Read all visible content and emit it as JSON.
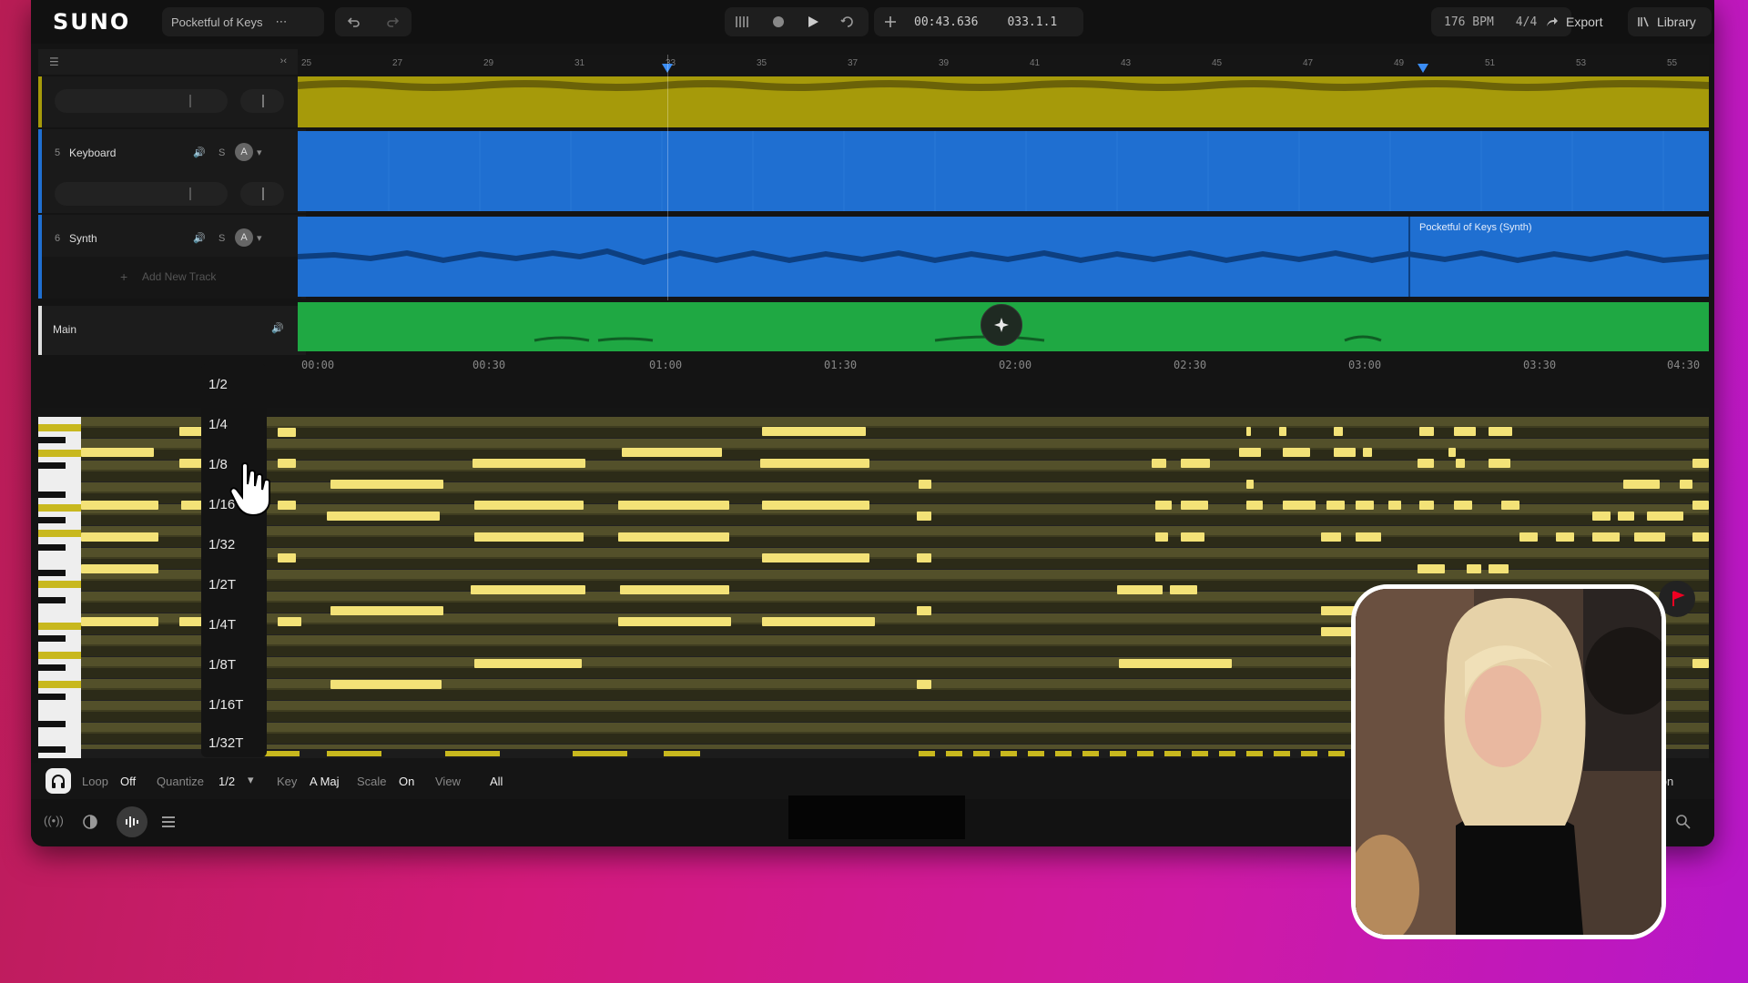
{
  "app": {
    "logo": "SUNO"
  },
  "header": {
    "project_title": "Pocketful of Keys",
    "more_label": "⋯",
    "time_display": "00:43.636",
    "bar_display": "033.1.1",
    "bpm": "176 BPM",
    "time_signature": "4/4",
    "export_label": "Export",
    "library_label": "Library"
  },
  "ruler_bars": [
    "25",
    "27",
    "29",
    "31",
    "33",
    "35",
    "37",
    "39",
    "41",
    "43",
    "45",
    "47",
    "49",
    "51",
    "53",
    "55"
  ],
  "tracks": [
    {
      "number": "",
      "name": "",
      "color": "#a69a0a"
    },
    {
      "number": "5",
      "name": "Keyboard",
      "color": "#1f6fd1",
      "solo": "S",
      "auto": "A"
    },
    {
      "number": "6",
      "name": "Synth",
      "color": "#1f6fd1",
      "solo": "S",
      "auto": "A",
      "clip_label": "Pocketful of Keys (Synth)"
    },
    {
      "name": "Main",
      "color": "#1fa843"
    }
  ],
  "add_track_label": "Add New Track",
  "time_ruler": [
    "00:00",
    "00:30",
    "01:00",
    "01:30",
    "02:00",
    "02:30",
    "03:00",
    "03:30",
    "04:30"
  ],
  "quantize_menu": [
    "1/2",
    "1/4",
    "1/8",
    "1/16",
    "1/32",
    "1/2T",
    "1/4T",
    "1/8T",
    "1/16T",
    "1/32T"
  ],
  "bottom": {
    "loop_label": "Loop",
    "loop_value": "Off",
    "quantize_label": "Quantize",
    "quantize_value": "1/2",
    "key_label": "Key",
    "key_value": "A Maj",
    "scale_label": "Scale",
    "scale_value": "On",
    "view_label": "View",
    "view_value": "All",
    "right_label": "ation"
  },
  "colors": {
    "accent_yellow": "#f3e277",
    "track_yellow": "#a69a0a",
    "track_blue": "#1f6fd1",
    "track_green": "#1fa843"
  }
}
